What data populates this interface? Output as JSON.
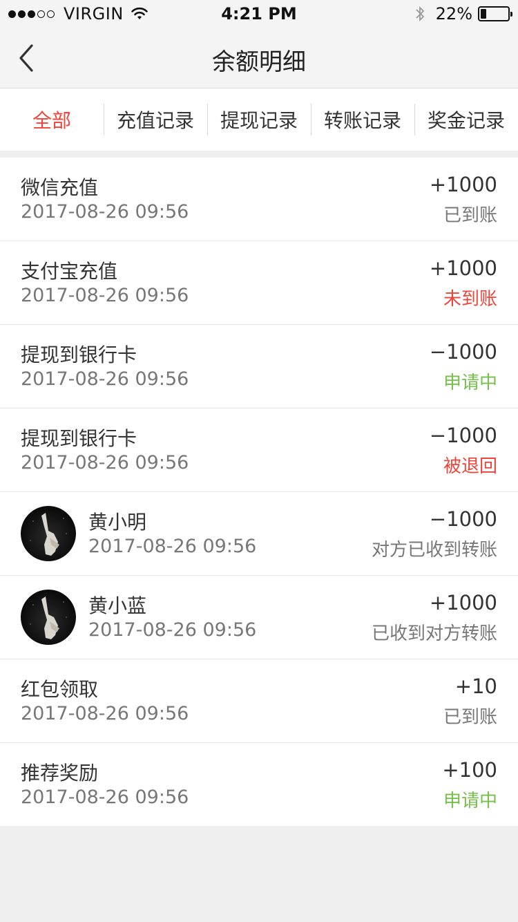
{
  "status_bar": {
    "carrier": "VIRGIN",
    "time": "4:21 PM",
    "battery_percent": "22%",
    "battery_level": 0.22,
    "signal_bars": 3
  },
  "nav": {
    "title": "余额明细",
    "back_icon": "chevron-left-icon"
  },
  "tabs": [
    {
      "label": "全部",
      "active": true
    },
    {
      "label": "充值记录",
      "active": false
    },
    {
      "label": "提现记录",
      "active": false
    },
    {
      "label": "转账记录",
      "active": false
    },
    {
      "label": "奖金记录",
      "active": false
    }
  ],
  "colors": {
    "accent_red": "#f04438",
    "success_green": "#74c14a",
    "muted_gray": "#777777"
  },
  "records": [
    {
      "title": "微信充值",
      "date": "2017-08-26 09:56",
      "amount": "+1000",
      "status": "已到账",
      "status_color": "gray",
      "avatar": false
    },
    {
      "title": "支付宝充值",
      "date": "2017-08-26 09:56",
      "amount": "+1000",
      "status": "未到账",
      "status_color": "red",
      "avatar": false
    },
    {
      "title": "提现到银行卡",
      "date": "2017-08-26 09:56",
      "amount": "−1000",
      "status": "申请中",
      "status_color": "green",
      "avatar": false
    },
    {
      "title": "提现到银行卡",
      "date": "2017-08-26 09:56",
      "amount": "−1000",
      "status": "被退回",
      "status_color": "red",
      "avatar": false
    },
    {
      "title": "黄小明",
      "date": "2017-08-26 09:56",
      "amount": "−1000",
      "status": "对方已收到转账",
      "status_color": "gray",
      "avatar": true
    },
    {
      "title": "黄小蓝",
      "date": "2017-08-26 09:56",
      "amount": "+1000",
      "status": "已收到对方转账",
      "status_color": "gray",
      "avatar": true
    },
    {
      "title": "红包领取",
      "date": "2017-08-26 09:56",
      "amount": "+10",
      "status": "已到账",
      "status_color": "gray",
      "avatar": false
    },
    {
      "title": "推荐奖励",
      "date": "2017-08-26 09:56",
      "amount": "+100",
      "status": "申请中",
      "status_color": "green",
      "avatar": false
    }
  ]
}
